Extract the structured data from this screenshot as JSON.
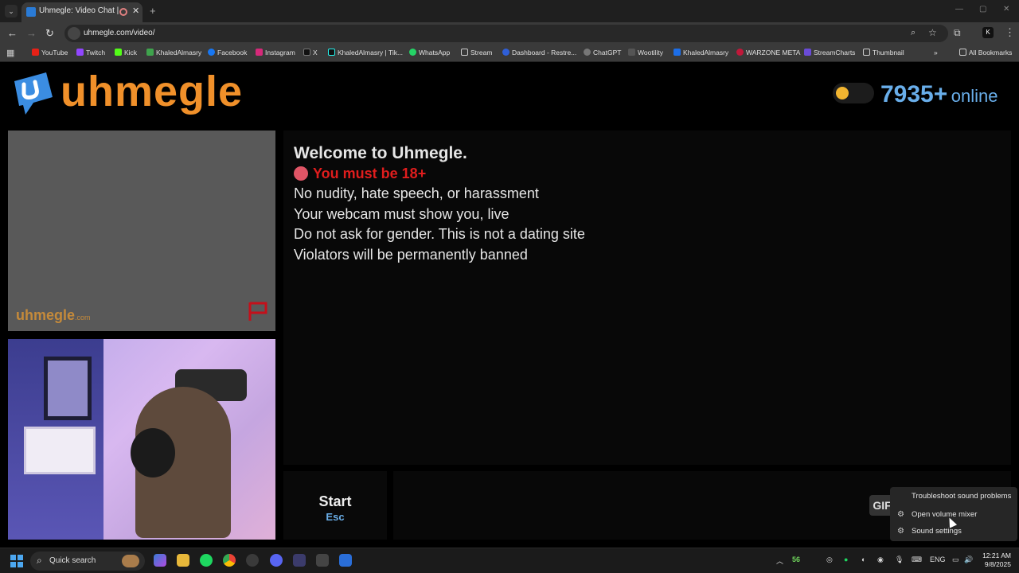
{
  "browser": {
    "tab_title": "Uhmegle: Video Chat | Ome",
    "url": "uhmegle.com/video/",
    "bookmarks": [
      "YouTube",
      "Twitch",
      "Kick",
      "KhaledAlmasry",
      "Facebook",
      "Instagram",
      "X",
      "KhaledAlmasry | Tik...",
      "WhatsApp",
      "Stream",
      "Dashboard - Restre...",
      "ChatGPT",
      "Wootility",
      "KhaledAlmasry",
      "WARZONE META",
      "StreamCharts",
      "Thumbnail"
    ],
    "all_bookmarks": "All Bookmarks",
    "colors": {
      "tabbar": "#1f1f1f",
      "toolbar": "#3a3a3a"
    }
  },
  "site": {
    "logo_text": "uhmegle",
    "online_count": "7935+",
    "online_label": "online",
    "watermark": "uhmegle",
    "watermark_suffix": ".com",
    "colors": {
      "brand_orange": "#f0902a",
      "brand_blue": "#69aeea",
      "warning_red": "#e01d1d"
    }
  },
  "rules": {
    "welcome": "Welcome to Uhmegle.",
    "age_warning": "You must be 18+",
    "lines": [
      "No nudity, hate speech, or harassment",
      "Your webcam must show you, live",
      "Do not ask for gender. This is not a dating site",
      "Violators will be permanently banned"
    ]
  },
  "controls": {
    "start_label": "Start",
    "start_key": "Esc",
    "gif_label": "GIF"
  },
  "context_menu": {
    "items": [
      "Troubleshoot sound problems",
      "Open volume mixer",
      "Sound settings"
    ]
  },
  "taskbar": {
    "search_placeholder": "Quick search",
    "tray_number": "56",
    "language": "ENG",
    "time": "12:21 AM",
    "date": "9/8/2025"
  }
}
